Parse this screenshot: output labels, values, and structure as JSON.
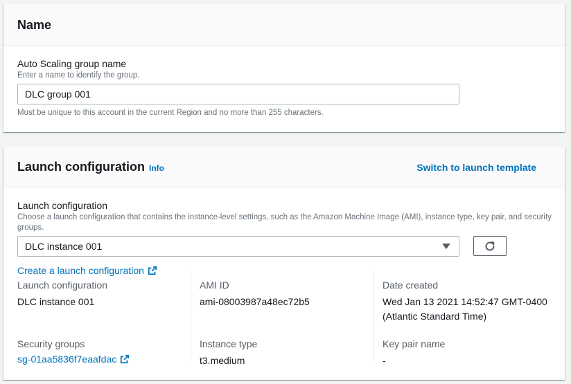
{
  "name_panel": {
    "title": "Name",
    "asg_label": "Auto Scaling group name",
    "asg_desc": "Enter a name to identify the group.",
    "asg_value": "DLC group 001",
    "asg_constraint": "Must be unique to this account in the current Region and no more than 255 characters."
  },
  "launch_panel": {
    "title": "Launch configuration",
    "info_label": "Info",
    "switch_label": "Switch to launch template",
    "lc_label": "Launch configuration",
    "lc_desc": "Choose a launch configuration that contains the instance-level settings, such as the Amazon Machine Image (AMI), instance type, key pair, and security groups.",
    "lc_selected": "DLC instance 001",
    "create_link": "Create a launch configuration",
    "details": {
      "lc_label": "Launch configuration",
      "lc_value": "DLC instance 001",
      "ami_label": "AMI ID",
      "ami_value": "ami-08003987a48ec72b5",
      "date_label": "Date created",
      "date_value_line1": "Wed Jan 13 2021 14:52:47 GMT-0400",
      "date_value_line2": "(Atlantic Standard Time)",
      "sg_label": "Security groups",
      "sg_value": "sg-01aa5836f7eaafdac",
      "type_label": "Instance type",
      "type_value": "t3.medium",
      "key_label": "Key pair name",
      "key_value": "-"
    }
  },
  "colors": {
    "link": "#0073bb",
    "text": "#16191f",
    "muted": "#687078",
    "background": "#f2f3f3"
  },
  "icons": [
    "external-link-icon",
    "refresh-icon",
    "caret-down-icon"
  ]
}
